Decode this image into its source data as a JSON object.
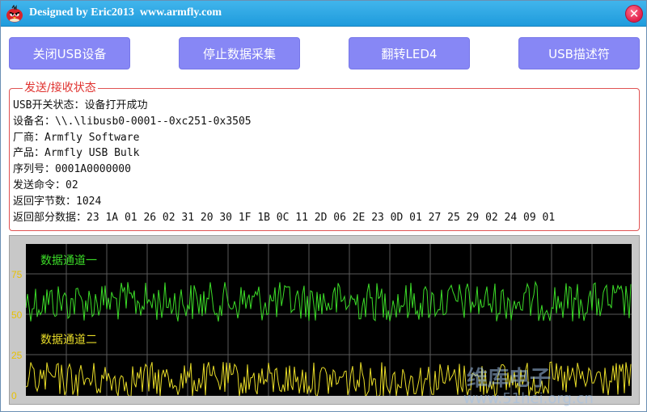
{
  "window": {
    "title": "Designed by Eric2013  www.armfly.com",
    "close_glyph": "✕"
  },
  "toolbar": {
    "buttons": [
      {
        "label": "关闭USB设备"
      },
      {
        "label": "停止数据采集"
      },
      {
        "label": "翻转LED4"
      },
      {
        "label": "USB描述符"
      }
    ]
  },
  "status_group": {
    "title": "发送/接收状态",
    "lines": [
      "USB开关状态：设备打开成功",
      "设备名：\\\\.\\libusb0-0001--0xc251-0x3505",
      "厂商：Armfly Software",
      "产品：Armfly USB Bulk",
      "序列号：0001A0000000",
      "发送命令：02",
      "返回字节数：1024",
      "返回部分数据：23 1A 01 26 02 31 20 30 1F 1B 0C 11 2D 06 2E 23 0D 01 27 25 29 02 24 09 01"
    ]
  },
  "scope": {
    "y_ticks": [
      "75",
      "50",
      "25",
      "0"
    ],
    "channels": [
      {
        "name": "数据通道一",
        "color": "#3cdc28"
      },
      {
        "name": "数据通道二",
        "color": "#e8dc28"
      }
    ],
    "grid_color": "#5a5a5a",
    "background": "#000000",
    "tick_color": "#e8c100"
  },
  "watermark": {
    "text": "www.51hei.org.cn",
    "note": "faded watermark text is partially occluded"
  },
  "icons": {
    "app": "angry-bird-icon",
    "close": "close-icon"
  }
}
